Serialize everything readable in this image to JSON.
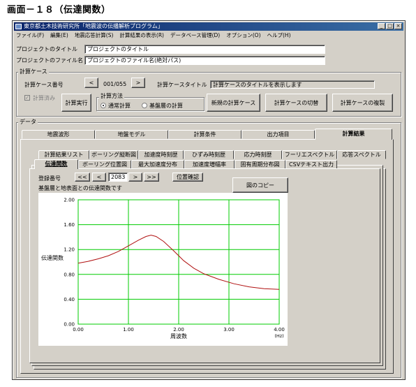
{
  "heading": "画面－１８（伝達関数）",
  "window": {
    "title": "東京都土木技術研究所「地震波の伝播解析プログラム」",
    "controls": [
      "_",
      "□",
      "×"
    ]
  },
  "menu": [
    "ファイル(F)",
    "編集(E)",
    "地震応答計算(S)",
    "計算結果の表示(R)",
    "データベース管理(D)",
    "オプション(O)",
    "ヘルプ(H)"
  ],
  "project": {
    "title_label": "プロジェクトのタイトル",
    "title_value": "プロジェクトのタイトル",
    "file_label": "プロジェクトのファイル名",
    "file_value": "プロジェクトのファイル名(絶対パス)"
  },
  "calc_case": {
    "group_label": "計算ケース",
    "number_label": "計算ケース番号",
    "prev": "<",
    "number_value": "001/055",
    "next": ">",
    "case_title_label": "計算ケースタイトル",
    "case_title_value": "計算ケースのタイトルを表示します",
    "done_label": "計算済み",
    "run_button": "計算実行",
    "method_label": "計算方法",
    "method_normal": "通常計算",
    "method_base": "基盤層の計算",
    "new_button": "新規の計算ケース",
    "switch_button": "計算ケースの切替",
    "copy_button": "計算ケースの複製"
  },
  "data_group_label": "データ",
  "main_tabs": [
    "地震波形",
    "地盤モデル",
    "計算条件",
    "出力項目",
    "計算結果"
  ],
  "main_active": 4,
  "result_tabs_row1": [
    "計算結果リスト",
    "ボーリング縦断図",
    "加速度時刻歴",
    "ひずみ時刻歴",
    "応力時刻歴",
    "フーリエスペクトル",
    "応答スペクトル"
  ],
  "result_tabs_row2": [
    "伝達関数",
    "ボーリング位置図",
    "最大加速度分布",
    "加速度増幅率",
    "固有周期分布図",
    "CSVテキスト出力"
  ],
  "result_active": "伝達関数",
  "nav": {
    "reg_label": "登録番号",
    "first": "<<",
    "prev": "<",
    "number": "2083",
    "next": ">",
    "last": ">>",
    "locate_button": "位置確認",
    "copy_fig_button": "図のコピー",
    "description": "基盤層と地表面との伝達関数です"
  },
  "chart_data": {
    "type": "line",
    "title": "",
    "xlabel": "周波数",
    "xunit": "(Hz)",
    "ylabel": "伝達関数",
    "xlim": [
      0,
      4
    ],
    "ylim": [
      0,
      2
    ],
    "xticks": [
      "0.00",
      "1.00",
      "2.00",
      "3.00",
      "4.00"
    ],
    "yticks": [
      "0.00",
      "0.40",
      "0.80",
      "1.20",
      "1.60",
      "2.00"
    ],
    "grid": true,
    "line_color": "#b01010",
    "grid_color": "#00cc00",
    "series": [
      {
        "x": [
          0.0,
          0.2,
          0.4,
          0.6,
          0.8,
          1.0,
          1.2,
          1.35,
          1.45,
          1.55,
          1.7,
          1.9,
          2.1,
          2.3,
          2.5,
          2.8,
          3.1,
          3.4,
          3.7,
          4.0
        ],
        "values": [
          0.98,
          1.01,
          1.05,
          1.1,
          1.17,
          1.26,
          1.35,
          1.41,
          1.43,
          1.41,
          1.33,
          1.18,
          1.02,
          0.9,
          0.81,
          0.72,
          0.65,
          0.6,
          0.57,
          0.56
        ]
      }
    ]
  }
}
